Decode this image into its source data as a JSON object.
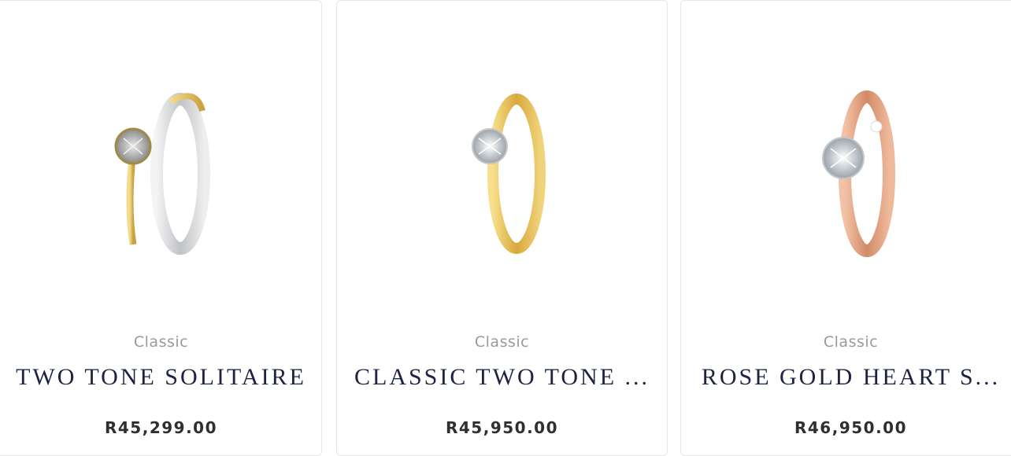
{
  "products": [
    {
      "category": "Classic",
      "title": "TWO TONE SOLITAIRE",
      "price": "R45,299.00",
      "image_icon": "two-tone-ring-icon"
    },
    {
      "category": "Classic",
      "title": "CLASSIC TWO TONE ...",
      "price": "R45,950.00",
      "image_icon": "yellow-gold-ring-icon"
    },
    {
      "category": "Classic",
      "title": "ROSE GOLD HEART S...",
      "price": "R46,950.00",
      "image_icon": "rose-gold-ring-icon"
    }
  ],
  "colors": {
    "title": "#1d2340",
    "category": "#9a9a9a",
    "price": "#2f2f2f",
    "card_border": "#e6e6e6"
  }
}
